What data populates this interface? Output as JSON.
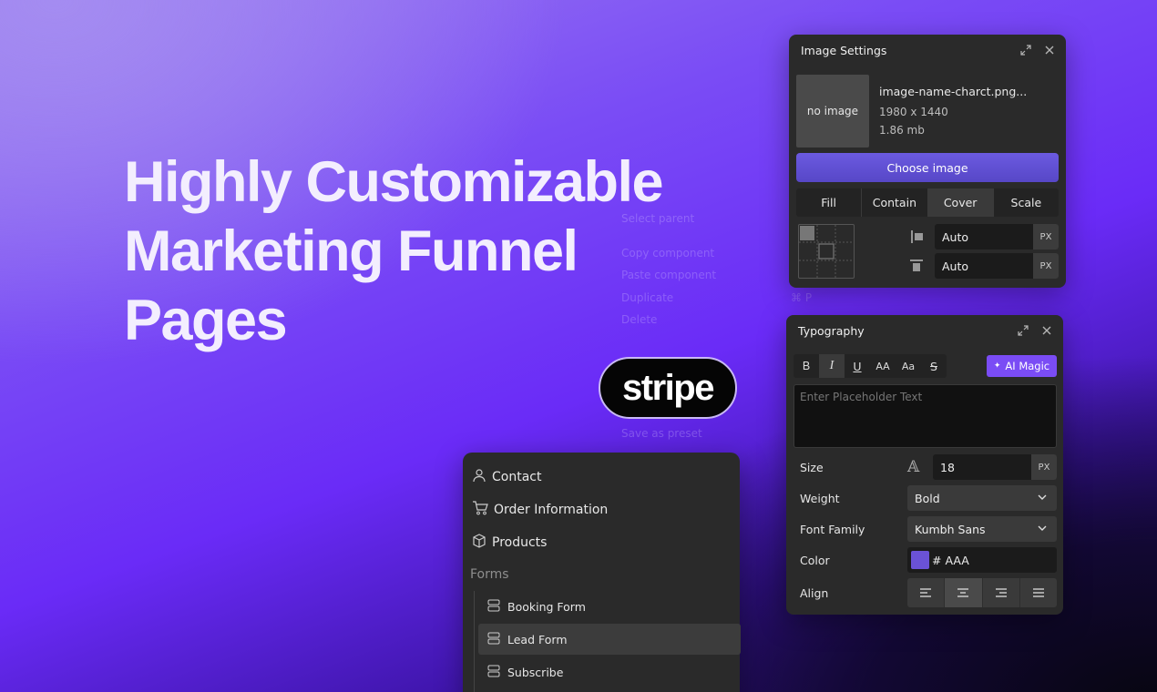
{
  "hero": {
    "lines": [
      "Highly Customizable",
      "Marketing Funnel",
      "Pages"
    ]
  },
  "context_menu": {
    "items": [
      "Select parent",
      "Copy component",
      "Paste component",
      "Duplicate",
      "Delete",
      "Save as preset"
    ],
    "shortcut_glyph": "⌘",
    "shortcut_key": "P"
  },
  "stripe": {
    "logo_text": "stripe"
  },
  "image_settings": {
    "title": "Image Settings",
    "thumbnail_text": "no image",
    "file_name": "image-name-charct.png...",
    "dimensions": "1980 x 1440",
    "file_size": "1.86 mb",
    "choose_label": "Choose image",
    "fit_options": [
      "Fill",
      "Contain",
      "Cover",
      "Scale"
    ],
    "active_fit": "Cover",
    "width_value": "Auto",
    "height_value": "Auto",
    "unit": "PX"
  },
  "typography": {
    "title": "Typography",
    "format_buttons": [
      "B",
      "I",
      "U",
      "AA",
      "Aa",
      "S"
    ],
    "ai_label": "AI Magic",
    "placeholder": "Enter Placeholder Text",
    "size_label": "Size",
    "size_value": "18",
    "size_unit": "PX",
    "weight_label": "Weight",
    "weight_value": "Bold",
    "family_label": "Font Family",
    "family_value": "Kumbh Sans",
    "color_label": "Color",
    "color_value": "# AAA",
    "color_swatch": "#6a52d6",
    "align_label": "Align"
  },
  "nav": {
    "items": [
      {
        "label": "Contact",
        "icon": "user-icon"
      },
      {
        "label": "Order Information",
        "icon": "cart-icon"
      },
      {
        "label": "Products",
        "icon": "box-icon"
      }
    ],
    "section_label": "Forms",
    "forms": [
      {
        "label": "Booking Form",
        "icon": "form-icon"
      },
      {
        "label": "Lead Form",
        "icon": "form-icon"
      },
      {
        "label": "Subscribe",
        "icon": "form-icon"
      }
    ],
    "selected_form": "Lead Form"
  },
  "colors": {
    "accent": "#7a4cf5",
    "button": "#5747c7",
    "panel": "#2a2a2a"
  }
}
